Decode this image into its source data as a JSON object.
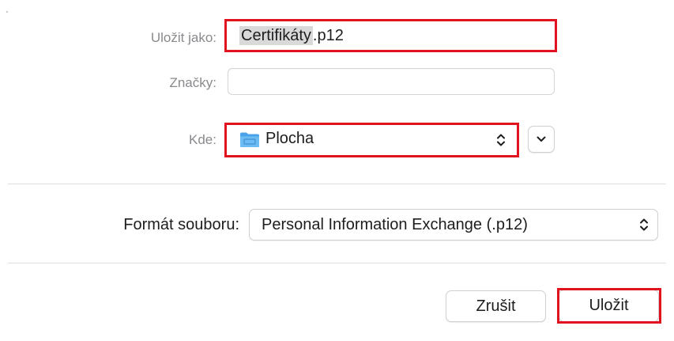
{
  "dialog": {
    "save_as": {
      "label": "Uložit jako:",
      "filename_selected": "Certifikáty",
      "filename_rest": ".p12"
    },
    "tags": {
      "label": "Značky:",
      "value": ""
    },
    "where": {
      "label": "Kde:",
      "value": "Plocha",
      "icon": "folder-icon"
    },
    "format": {
      "label": "Formát souboru:",
      "value": "Personal Information Exchange (.p12)"
    },
    "buttons": {
      "cancel": "Zrušit",
      "save": "Uložit"
    }
  },
  "colors": {
    "highlight": "#e0131f",
    "folder": "#5ab0ee",
    "selection": "#d9d9d9"
  }
}
